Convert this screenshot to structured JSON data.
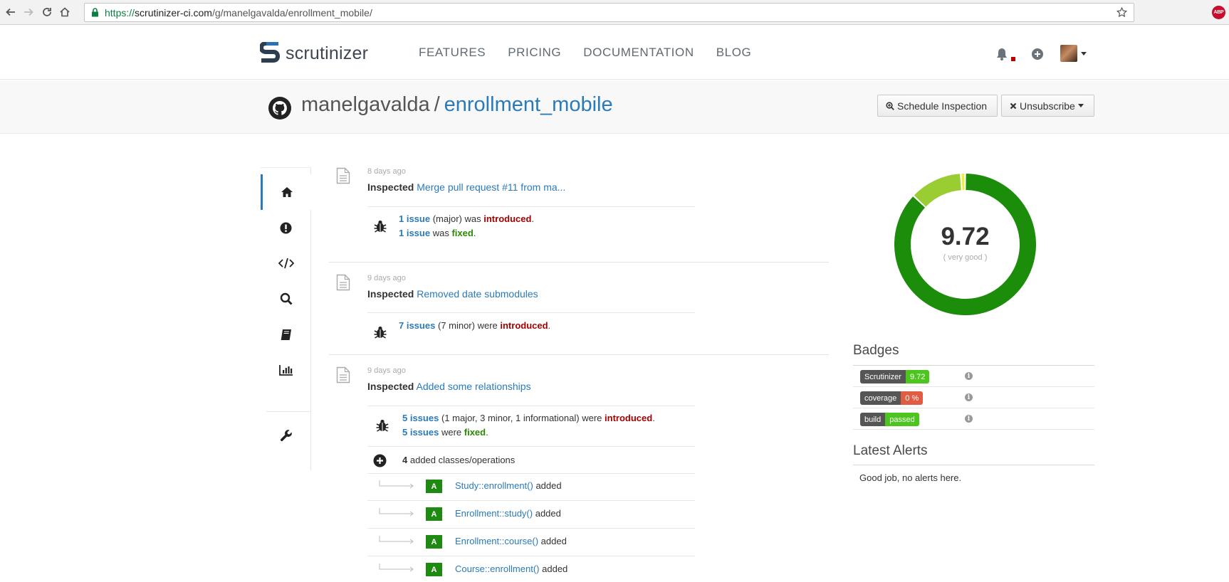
{
  "browser": {
    "url_protocol": "https://",
    "url_host": "scrutinizer-ci.com",
    "url_path": "/g/manelgavalda/enrollment_mobile/",
    "extension_label": "ABP"
  },
  "header": {
    "logo_text": "scrutinizer",
    "nav": [
      "FEATURES",
      "PRICING",
      "DOCUMENTATION",
      "BLOG"
    ]
  },
  "repo": {
    "owner": "manelgavalda",
    "separator": "/",
    "name": "enrollment_mobile",
    "schedule_label": "Schedule Inspection",
    "unsubscribe_label": "Unsubscribe"
  },
  "sidebar": {
    "items": [
      "home-icon",
      "exclamation-icon",
      "code-icon",
      "search-icon",
      "book-icon",
      "bar-chart-icon",
      "wrench-icon"
    ]
  },
  "timeline": [
    {
      "time": "8 days ago",
      "verb": "Inspected",
      "commit": "Merge pull request #11 from ma...",
      "introduced_count": "1 issue",
      "introduced_detail": "(major) was",
      "introduced_word": "introduced",
      "fixed_count": "1 issue",
      "fixed_detail": "was",
      "fixed_word": "fixed"
    },
    {
      "time": "9 days ago",
      "verb": "Inspected",
      "commit": "Removed date submodules",
      "introduced_count": "7 issues",
      "introduced_detail": "(7 minor) were",
      "introduced_word": "introduced"
    },
    {
      "time": "9 days ago",
      "verb": "Inspected",
      "commit": "Added some relationships",
      "introduced_count": "5 issues",
      "introduced_detail": "(1 major, 3 minor, 1 informational) were",
      "introduced_word": "introduced",
      "fixed_count": "5 issues",
      "fixed_detail": "were",
      "fixed_word": "fixed",
      "added_count": "4",
      "added_text": "added classes/operations",
      "methods": [
        {
          "badge": "A",
          "name": "Study::enrollment()",
          "status": "added"
        },
        {
          "badge": "A",
          "name": "Enrollment::study()",
          "status": "added"
        },
        {
          "badge": "A",
          "name": "Enrollment::course()",
          "status": "added"
        },
        {
          "badge": "A",
          "name": "Course::enrollment()",
          "status": "added"
        }
      ]
    }
  ],
  "quality": {
    "score": "9.72",
    "rating": "( very good )",
    "distribution": [
      0.87,
      0.12,
      0.01
    ],
    "colors": [
      "#1c8c0b",
      "#9acd32",
      "#e8f040"
    ]
  },
  "badges": {
    "title": "Badges",
    "items": [
      {
        "label": "Scrutinizer",
        "value": "9.72",
        "color": "#4cc61e"
      },
      {
        "label": "coverage",
        "value": "0 %",
        "color": "#e05d44"
      },
      {
        "label": "build",
        "value": "passed",
        "color": "#4cc61e"
      }
    ]
  },
  "alerts": {
    "title": "Latest Alerts",
    "text": "Good job, no alerts here."
  }
}
